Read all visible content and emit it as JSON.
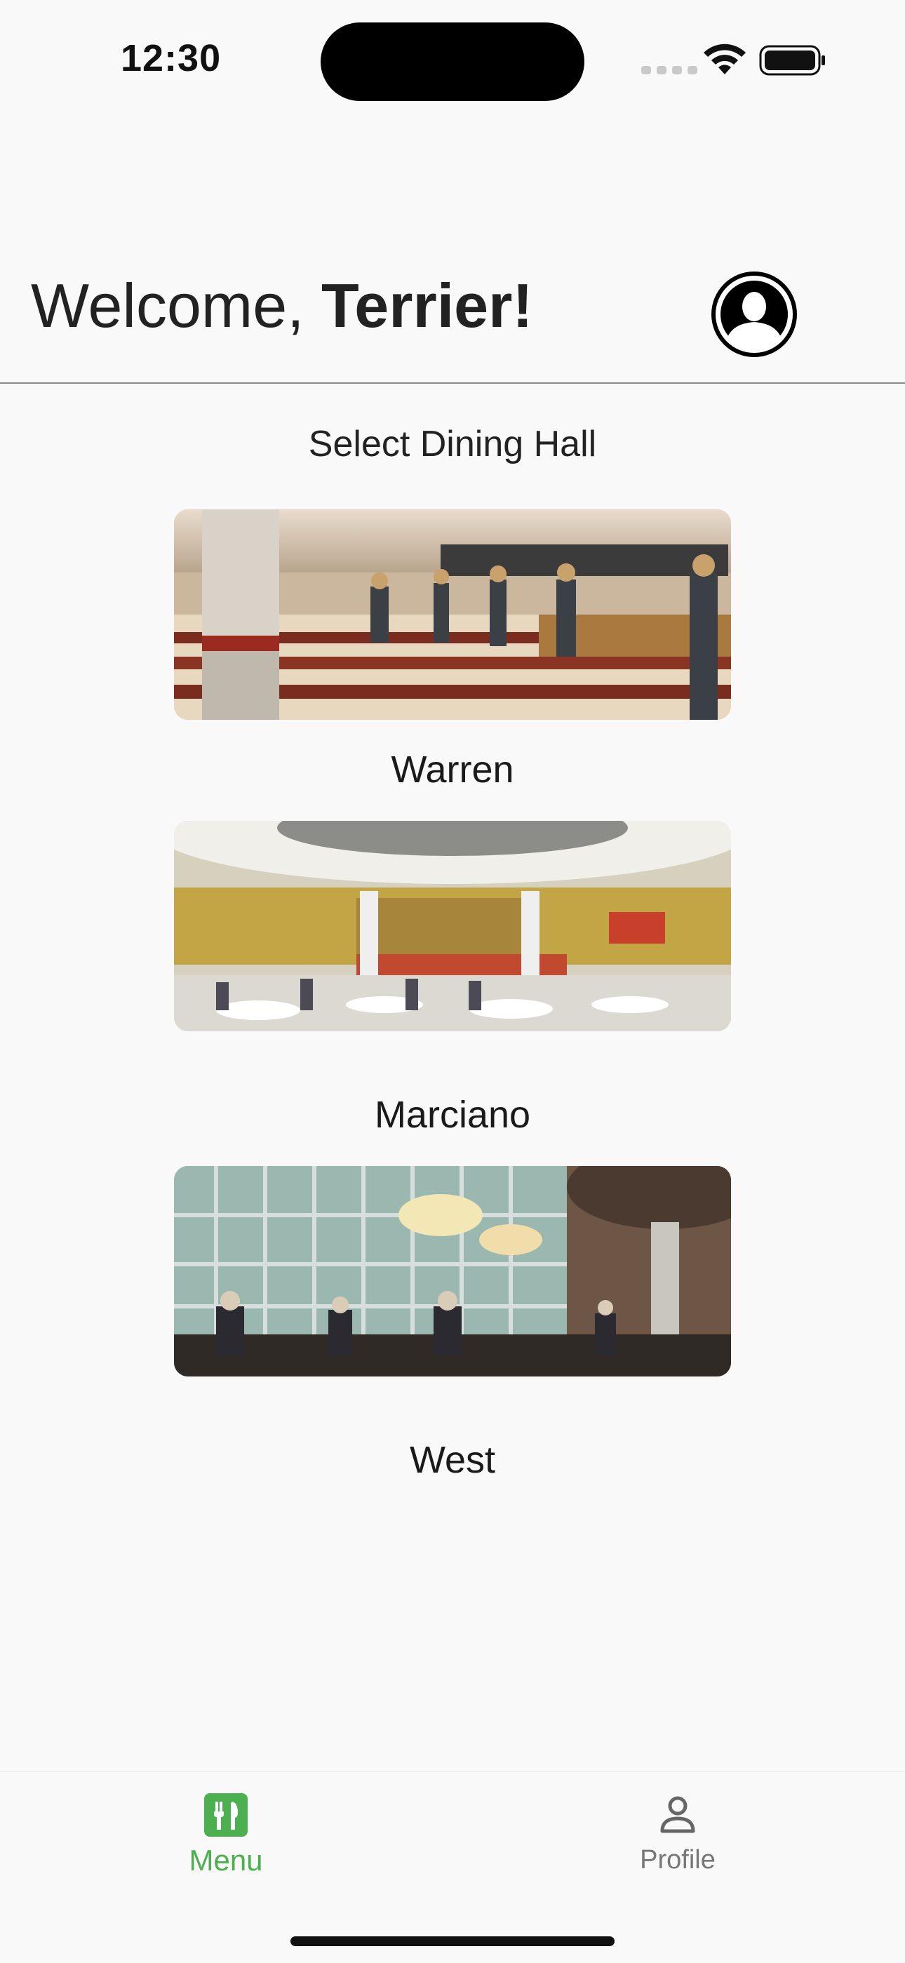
{
  "status_bar": {
    "time": "12:30",
    "icons": [
      "cellular-signal-icon",
      "wifi-icon",
      "battery-icon"
    ]
  },
  "header": {
    "greeting": "Welcome, ",
    "name": "Terrier!",
    "avatar_icon": "user-avatar-icon"
  },
  "main": {
    "section_title": "Select Dining Hall",
    "halls": [
      {
        "name": "Warren",
        "photo": "dining-hall-photo"
      },
      {
        "name": "Marciano",
        "photo": "dining-hall-photo"
      },
      {
        "name": "West",
        "photo": "dining-hall-photo"
      }
    ]
  },
  "tabbar": {
    "tabs": [
      {
        "label": "Menu",
        "icon": "fork-knife-icon",
        "active": true
      },
      {
        "label": "Profile",
        "icon": "person-icon",
        "active": false
      }
    ]
  },
  "colors": {
    "accent": "#4caf50",
    "background": "#f9f9f9",
    "inactive_tab": "#777777"
  }
}
